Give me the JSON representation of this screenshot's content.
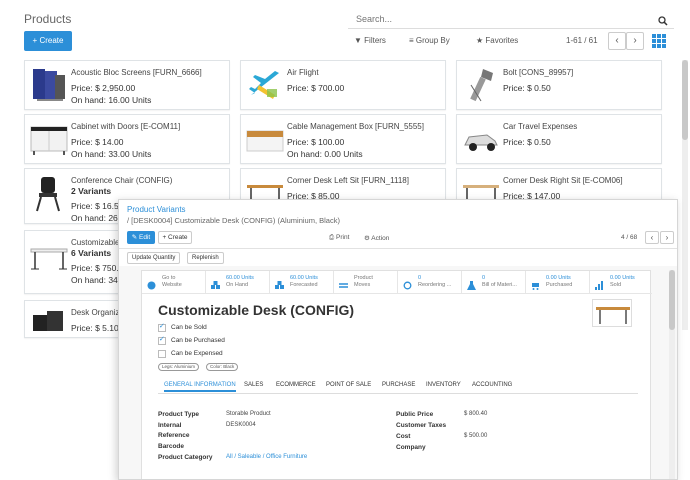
{
  "header": {
    "title": "Products",
    "search_placeholder": "Search...",
    "create_label": "+ Create",
    "filters_label": "Filters",
    "groupby_label": "Group By",
    "favorites_label": "Favorites",
    "pager": "1-61 / 61"
  },
  "products": [
    {
      "name": "Acoustic Bloc Screens [FURN_6666]",
      "price": "Price: $ 2,950.00",
      "onhand": "On hand: 16.00 Units",
      "variants": "",
      "icon": "screen-panels"
    },
    {
      "name": "Air Flight",
      "price": "Price: $ 700.00",
      "onhand": "",
      "variants": "",
      "icon": "airplane"
    },
    {
      "name": "Bolt [CONS_89957]",
      "price": "Price: $ 0.50",
      "onhand": "",
      "variants": "",
      "icon": "bolt"
    },
    {
      "name": "Cabinet with Doors [E-COM11]",
      "price": "Price: $ 14.00",
      "onhand": "On hand: 33.00 Units",
      "variants": "",
      "icon": "cabinet"
    },
    {
      "name": "Cable Management Box [FURN_5555]",
      "price": "Price: $ 100.00",
      "onhand": "On hand: 0.00 Units",
      "variants": "",
      "icon": "cable-box"
    },
    {
      "name": "Car Travel Expenses",
      "price": "Price: $ 0.50",
      "onhand": "",
      "variants": "",
      "icon": "car"
    },
    {
      "name": "Conference Chair (CONFIG)",
      "price": "Price: $ 16.50",
      "onhand": "On hand: 26",
      "variants": "2 Variants",
      "icon": "chair"
    },
    {
      "name": "Corner Desk Left Sit [FURN_1118]",
      "price": "Price: $ 85.00",
      "onhand": "",
      "variants": "",
      "icon": "desk"
    },
    {
      "name": "Corner Desk Right Sit [E-COM06]",
      "price": "Price: $ 147.00",
      "onhand": "",
      "variants": "",
      "icon": "desk"
    },
    {
      "name": "Customizable",
      "price": "Price: $ 750.",
      "onhand": "On hand: 34",
      "variants": "6 Variants",
      "icon": "desk-white"
    },
    {
      "name": "Desk Organize",
      "price": "Price: $ 5.10",
      "onhand": "",
      "variants": "",
      "icon": "organizer"
    }
  ],
  "variant_form": {
    "breadcrumb_parent": "Product Variants",
    "breadcrumb_current": "/ [DESK0004] Customizable Desk (CONFIG) (Aluminium, Black)",
    "edit_label": "Edit",
    "create_label": "+ Create",
    "print_label": "Print",
    "action_label": "Action",
    "pager": "4 / 68",
    "update_qty_label": "Update Quantity",
    "replenish_label": "Replenish",
    "smart_buttons": [
      {
        "line1": "Go to",
        "line2": "Website",
        "icon": "globe"
      },
      {
        "line1": "60.00 Units",
        "line2": "On Hand",
        "icon": "cubes"
      },
      {
        "line1": "60.00 Units",
        "line2": "Forecasted",
        "icon": "cubes"
      },
      {
        "line1": "Product",
        "line2": "Moves",
        "icon": "exchange"
      },
      {
        "line1": "0",
        "line2": "Reordering ...",
        "icon": "refresh"
      },
      {
        "line1": "0",
        "line2": "Bill of Materi...",
        "icon": "flask"
      },
      {
        "line1": "0.00 Units",
        "line2": "Purchased",
        "icon": "cart"
      },
      {
        "line1": "0.00 Units",
        "line2": "Sold",
        "icon": "bar-chart"
      }
    ],
    "title": "Customizable Desk (CONFIG)",
    "can_be_sold": "Can be Sold",
    "can_be_purchased": "Can be Purchased",
    "can_be_expensed": "Can be Expensed",
    "tags": [
      "Legs: Aluminium",
      "Color: Black"
    ],
    "tabs": [
      "GENERAL INFORMATION",
      "SALES",
      "ECOMMERCE",
      "POINT OF SALE",
      "PURCHASE",
      "INVENTORY",
      "ACCOUNTING"
    ],
    "fields_left": [
      {
        "label": "Product Type",
        "value": "Storable Product"
      },
      {
        "label": "Internal",
        "value": "DESK0004"
      },
      {
        "label": "Reference",
        "value": ""
      },
      {
        "label": "Barcode",
        "value": ""
      },
      {
        "label": "Product Category",
        "value": "All / Saleable / Office Furniture"
      }
    ],
    "fields_right": [
      {
        "label": "Public Price",
        "value": "$ 800.40"
      },
      {
        "label": "Customer Taxes",
        "value": ""
      },
      {
        "label": "Cost",
        "value": "$ 500.00"
      },
      {
        "label": "Company",
        "value": ""
      }
    ]
  },
  "colors": {
    "accent": "#2c8fd8"
  }
}
